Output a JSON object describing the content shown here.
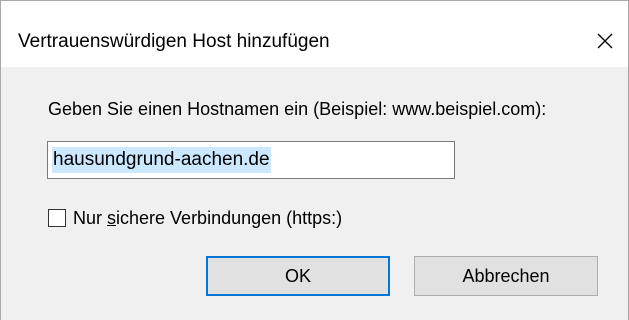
{
  "window": {
    "title": "Vertrauenswürdigen Host hinzufügen",
    "close_icon": "close-icon"
  },
  "form": {
    "prompt": "Geben Sie einen Hostnamen ein (Beispiel: www.beispiel.com):",
    "host_value": "hausundgrund-aachen.de",
    "https_only": {
      "label_before": "Nur ",
      "label_accel": "s",
      "label_after": "ichere Verbindungen (https:)",
      "checked": false
    }
  },
  "buttons": {
    "ok_label": "OK",
    "cancel_label": "Abbrechen"
  },
  "colors": {
    "focus_border": "#0078d7",
    "selection": "#cce8ff",
    "body_background": "#f0f0f0",
    "button_face": "#e1e1e1"
  }
}
